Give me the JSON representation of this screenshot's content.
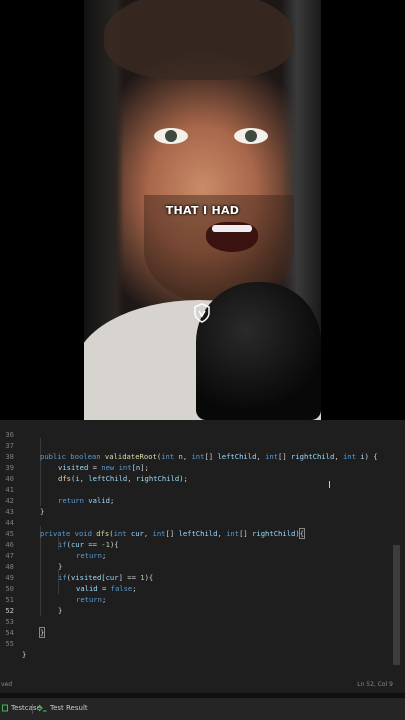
{
  "video": {
    "caption": "THAT I HAD"
  },
  "editor": {
    "lines": [
      {
        "n": "36",
        "text": ""
      },
      {
        "n": "37",
        "text": "public boolean validateRoot(int n, int[] leftChild, int[] rightChild, int i) {"
      },
      {
        "n": "38",
        "text": "    visited = new int[n];"
      },
      {
        "n": "39",
        "text": "    dfs(i, leftChild, rightChild);"
      },
      {
        "n": "40",
        "text": ""
      },
      {
        "n": "41",
        "text": "    return valid;"
      },
      {
        "n": "42",
        "text": "}"
      },
      {
        "n": "43",
        "text": ""
      },
      {
        "n": "44",
        "text": "private void dfs(int cur, int[] leftChild, int[] rightChild){"
      },
      {
        "n": "45",
        "text": "    if(cur == -1){"
      },
      {
        "n": "46",
        "text": "        return;"
      },
      {
        "n": "47",
        "text": "    }"
      },
      {
        "n": "48",
        "text": "    if(visited[cur] == 1){"
      },
      {
        "n": "49",
        "text": "        valid = false;"
      },
      {
        "n": "50",
        "text": "        return;"
      },
      {
        "n": "51",
        "text": "    }"
      },
      {
        "n": "52",
        "text": ""
      },
      {
        "n": "53",
        "text": "}"
      },
      {
        "n": "54",
        "text": ""
      },
      {
        "n": "55",
        "text": "}"
      }
    ]
  },
  "status": {
    "left": "ved",
    "position": "Ln 52, Col 9"
  },
  "bottom_tabs": [
    {
      "label": "Testcase",
      "icon": "checkbox-icon"
    },
    {
      "label": "Test Result",
      "icon": "terminal-icon"
    }
  ]
}
